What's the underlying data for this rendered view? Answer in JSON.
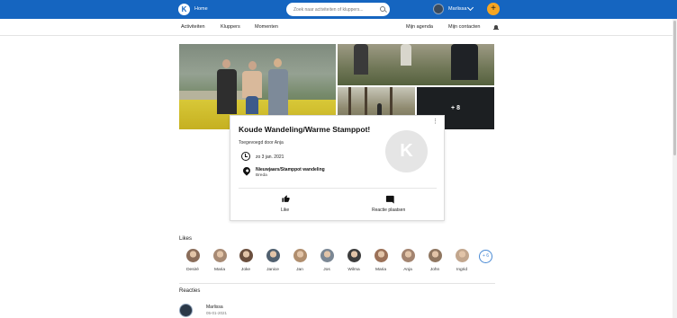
{
  "topbar": {
    "home_label": "Home",
    "search_placeholder": "Zoek naar activiteiten of kluppers...",
    "user_name": "Marlissa",
    "add_label": "+",
    "colors": {
      "bar": "#1565c0",
      "add": "#f5a623"
    }
  },
  "subnav": {
    "left": [
      "Activiteiten",
      "Kluppers",
      "Momenten"
    ],
    "right": [
      "Mijn agenda",
      "Mijn contacten"
    ]
  },
  "photos": {
    "more_count": "+ 8"
  },
  "event": {
    "title": "Koude Wandeling/Warme Stamppot!",
    "organizer": "Toegevoegd door Anja",
    "date": "zo 3 jan. 2021",
    "location_name": "Nieuwjaars/Stamppot wandeling",
    "location_city": "Breda",
    "like_label": "Like",
    "comment_label": "Reactie plaatsen",
    "menu": "⋮"
  },
  "likes": {
    "title": "Likes",
    "people": [
      "Desiré",
      "Maria",
      "Joke",
      "Janice",
      "Jan",
      "Jos",
      "Wilma",
      "Maria",
      "Anja",
      "John",
      "Ingrid"
    ],
    "more": "+ 6"
  },
  "reacties": {
    "title": "Reacties",
    "comment_user": "Marlissa",
    "comment_date": "05-01-2021"
  }
}
